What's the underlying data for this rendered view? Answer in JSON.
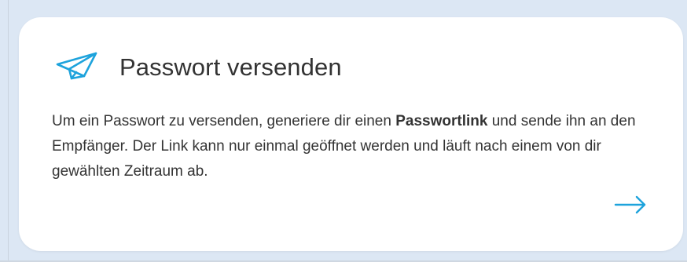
{
  "card": {
    "title": "Passwort versenden",
    "description_pre": "Um ein Passwort zu versenden, generiere dir einen ",
    "description_bold": "Passwortlink",
    "description_post": " und sende ihn an den Empfänger. Der Link kann nur einmal geöffnet werden und läuft nach einem von dir gewählten Zeitraum ab.",
    "icon": "paper-plane-icon",
    "action_icon": "arrow-right-icon"
  },
  "colors": {
    "background": "#dce7f4",
    "card": "#ffffff",
    "accent": "#1ea3dc",
    "text": "#333333"
  }
}
